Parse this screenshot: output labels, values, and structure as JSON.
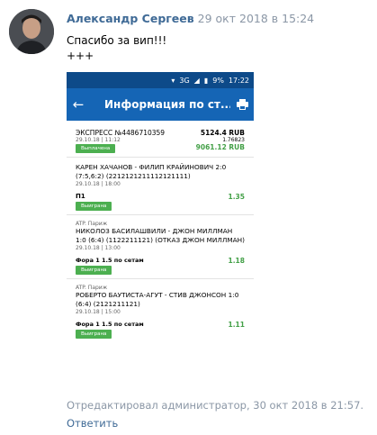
{
  "post": {
    "author": "Александр Сергеев",
    "date": "29 окт 2018 в 15:24",
    "text_line1": "Спасибо за вип!!!",
    "text_line2": "+++",
    "edited": "Отредактировал администратор, 30 окт 2018 в 21:57.",
    "reply": "Ответить"
  },
  "screenshot": {
    "status": {
      "network": "3G",
      "battery": "9%",
      "time": "17:22"
    },
    "app_title": "Информация по ст...",
    "express": {
      "title": "ЭКСПРЕСС №4486710359",
      "stake": "5124.4 RUB",
      "datetime": "29.10.18 | 11:12",
      "odds": "1.76823",
      "status": "Выплачена",
      "payout": "9061.12 RUB"
    },
    "events": [
      {
        "category": "",
        "title": "КАРЕН ХАЧАНОВ - ФИЛИП КРАЙИНОВИЧ 2:0 (7:5,6:2) (2212121211112121111)",
        "datetime": "29.10.18 | 18:00",
        "bet": "П1",
        "odds": "1.35",
        "status": "Выиграна"
      },
      {
        "category": "ATP. Париж",
        "title": "НИКОЛОЗ БАСИЛАШВИЛИ - ДЖОН МИЛЛМАН 1:0 (6:4) (1122211121) (ОТКАЗ ДЖОН МИЛЛМАН)",
        "datetime": "29.10.18 | 13:00",
        "bet": "Фора 1 1.5 по сетам",
        "odds": "1.18",
        "status": "Выиграна"
      },
      {
        "category": "ATP. Париж",
        "title": "РОБЕРТО БАУТИСТА-АГУТ - СТИВ ДЖОНСОН 1:0 (6:4) (2121211121)",
        "datetime": "29.10.18 | 15:00",
        "bet": "Фора 1 1.5 по сетам",
        "odds": "1.11",
        "status": "Выиграна"
      }
    ]
  },
  "colors": {
    "link": "#3f6a96",
    "muted": "#8b97a6",
    "appbar": "#1565b5",
    "statusbar": "#0d4a89",
    "win": "#4caf50"
  }
}
